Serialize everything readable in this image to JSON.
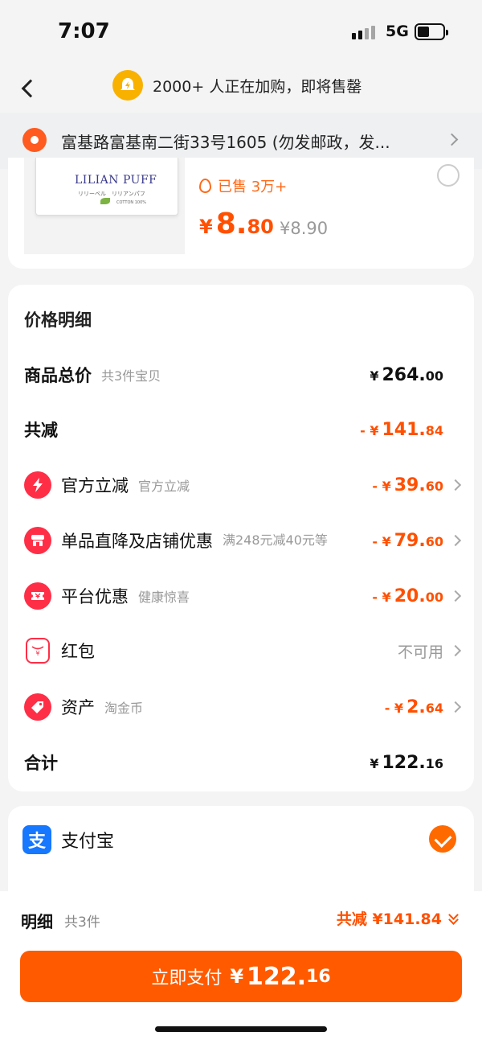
{
  "status": {
    "time": "7:07",
    "network": "5G"
  },
  "nav": {
    "title": "2000+ 人正在加购，即将售罄"
  },
  "address": {
    "text": "富基路富基南二街33号1605 (勿发邮政，发..."
  },
  "product": {
    "brand": "LILIAN PUFF",
    "brand_sub": "リリーベル　リリアンパフ",
    "cotton": "COTTON 100%",
    "sold": "已售 3万+",
    "price_symbol": "¥",
    "price_int": "8.",
    "price_dec": "80",
    "original_price": "¥8.90"
  },
  "detail": {
    "title": "价格明细",
    "rows": [
      {
        "label": "商品总价",
        "note": "共3件宝贝",
        "sym": "¥",
        "int": "264.",
        "dec": "00"
      },
      {
        "label": "共减",
        "note": "",
        "sym": "- ¥",
        "int": "141.",
        "dec": "84"
      },
      {
        "label": "官方立减",
        "note": "官方立减",
        "sym": "- ¥",
        "int": "39.",
        "dec": "60"
      },
      {
        "label": "单品直降及店铺优惠",
        "note": "满248元减40元等",
        "sym": "- ¥",
        "int": "79.",
        "dec": "60"
      },
      {
        "label": "平台优惠",
        "note": "健康惊喜",
        "sym": "- ¥",
        "int": "20.",
        "dec": "00"
      },
      {
        "label": "红包",
        "note": "",
        "value_text": "不可用"
      },
      {
        "label": "资产",
        "note": "淘金币",
        "sym": "- ¥",
        "int": "2.",
        "dec": "64"
      },
      {
        "label": "合计",
        "note": "",
        "sym": "¥",
        "int": "122.",
        "dec": "16"
      }
    ]
  },
  "payment": {
    "method": "支付宝",
    "icon_char": "支"
  },
  "summary": {
    "label": "明细",
    "count": "共3件",
    "total_discount": "共减 ¥141.84"
  },
  "pay_button": {
    "label": "立即支付",
    "sym": "¥",
    "int": "122.",
    "dec": "16"
  },
  "colors": {
    "accent": "#ff5000",
    "icon_red": "#ff2e47",
    "alipay": "#1677ff"
  }
}
